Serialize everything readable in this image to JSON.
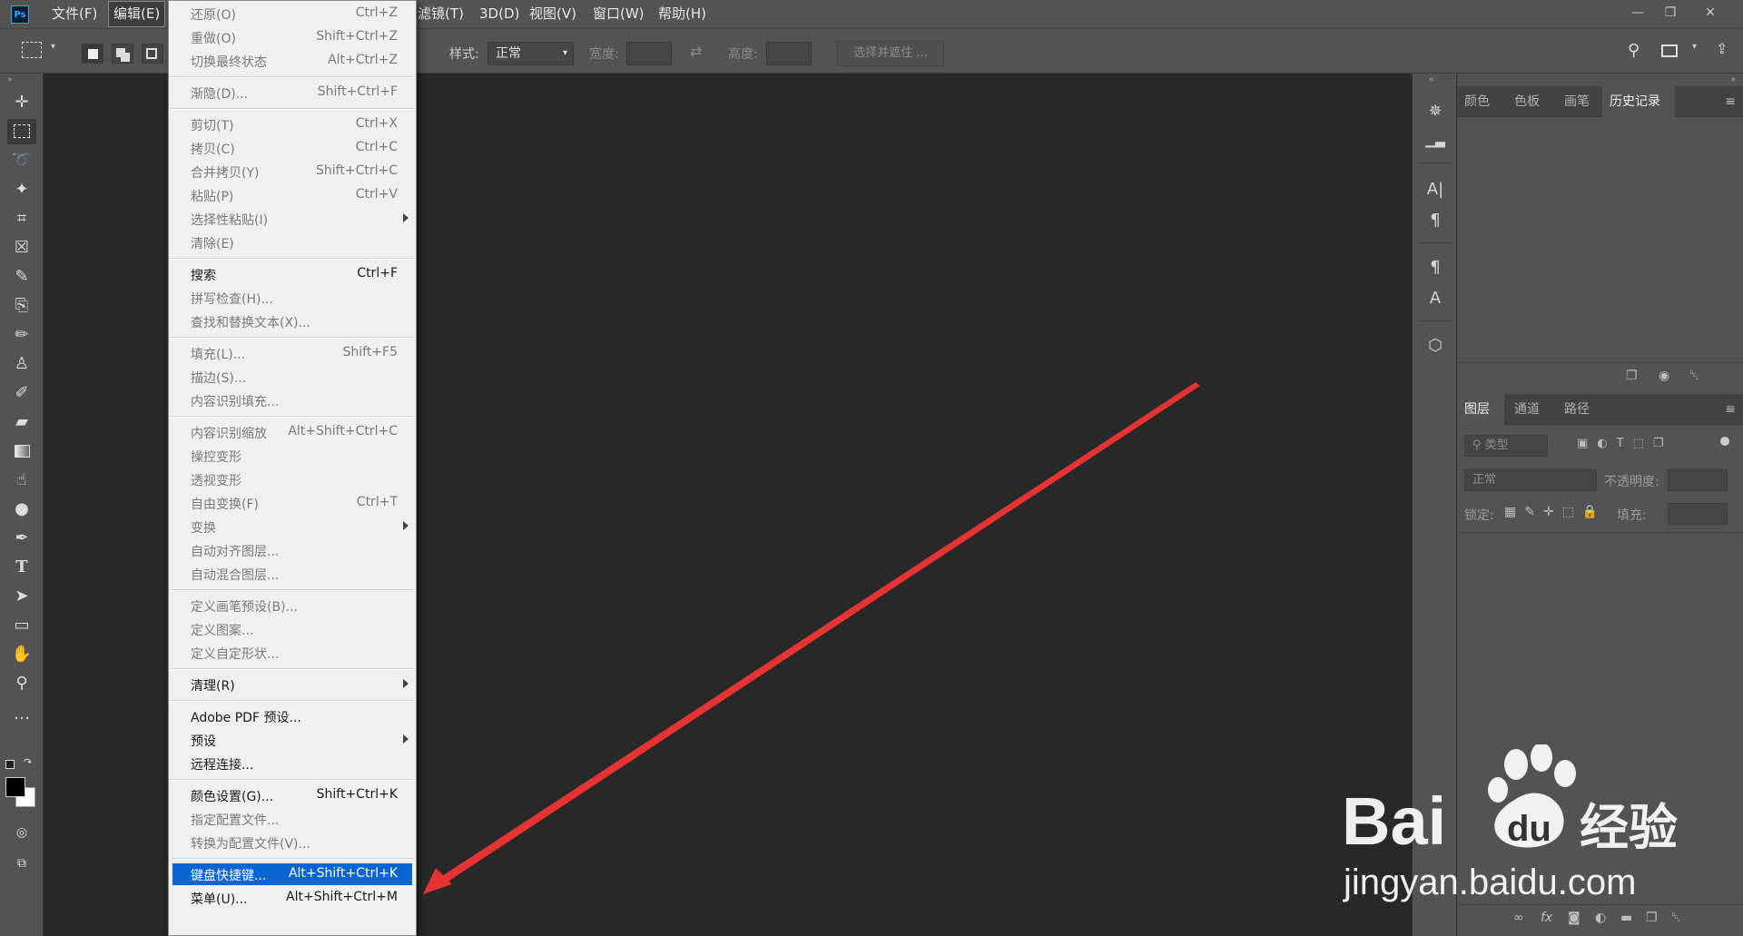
{
  "app": {
    "logo": "Ps"
  },
  "menubar": {
    "items": [
      "文件(F)",
      "编辑(E)",
      "滤镜(T)",
      "3D(D)",
      "视图(V)",
      "窗口(W)",
      "帮助(H)"
    ],
    "active": "编辑(E)"
  },
  "window": {
    "minimize_icon": "minimize-icon",
    "restore_icon": "restore-icon",
    "close_icon": "close-icon"
  },
  "options": {
    "style_label": "样式:",
    "style_value": "正常",
    "width_label": "宽度:",
    "height_label": "高度:",
    "select_mask_label": "选择并遮住 ..."
  },
  "tools": [
    "move-icon",
    "marquee-icon",
    "lasso-icon",
    "magic-wand-icon",
    "crop-icon",
    "frame-icon",
    "eyedropper-icon",
    "healing-icon",
    "brush-icon",
    "stamp-icon",
    "history-brush-icon",
    "eraser-icon",
    "gradient-icon",
    "smudge-icon",
    "dodge-icon",
    "pen-icon",
    "type-icon",
    "path-select-icon",
    "rectangle-icon",
    "hand-icon",
    "zoom-icon",
    "more-icon"
  ],
  "right_panel_top": {
    "tabs": [
      "颜色",
      "色板",
      "画笔",
      "历史记录"
    ],
    "active": "历史记录"
  },
  "layers_panel": {
    "tabs": [
      "图层",
      "通道",
      "路径"
    ],
    "active": "图层",
    "filter_placeholder": "类型",
    "blend_mode": "正常",
    "opacity_label": "不透明度:",
    "lock_label": "锁定:",
    "fill_label": "填充:"
  },
  "edit_menu": {
    "groups": [
      [
        {
          "label": "还原(O)",
          "shortcut": "Ctrl+Z",
          "enabled": false
        },
        {
          "label": "重做(O)",
          "shortcut": "Shift+Ctrl+Z",
          "enabled": false
        },
        {
          "label": "切换最终状态",
          "shortcut": "Alt+Ctrl+Z",
          "enabled": false
        }
      ],
      [
        {
          "label": "渐隐(D)...",
          "shortcut": "Shift+Ctrl+F",
          "enabled": false
        }
      ],
      [
        {
          "label": "剪切(T)",
          "shortcut": "Ctrl+X",
          "enabled": false
        },
        {
          "label": "拷贝(C)",
          "shortcut": "Ctrl+C",
          "enabled": false
        },
        {
          "label": "合并拷贝(Y)",
          "shortcut": "Shift+Ctrl+C",
          "enabled": false
        },
        {
          "label": "粘贴(P)",
          "shortcut": "Ctrl+V",
          "enabled": false
        },
        {
          "label": "选择性粘贴(I)",
          "shortcut": "",
          "enabled": false,
          "submenu": true
        },
        {
          "label": "清除(E)",
          "shortcut": "",
          "enabled": false
        }
      ],
      [
        {
          "label": "搜索",
          "shortcut": "Ctrl+F",
          "enabled": true
        },
        {
          "label": "拼写检查(H)...",
          "shortcut": "",
          "enabled": false
        },
        {
          "label": "查找和替换文本(X)...",
          "shortcut": "",
          "enabled": false
        }
      ],
      [
        {
          "label": "填充(L)...",
          "shortcut": "Shift+F5",
          "enabled": false
        },
        {
          "label": "描边(S)...",
          "shortcut": "",
          "enabled": false
        },
        {
          "label": "内容识别填充...",
          "shortcut": "",
          "enabled": false
        }
      ],
      [
        {
          "label": "内容识别缩放",
          "shortcut": "Alt+Shift+Ctrl+C",
          "enabled": false
        },
        {
          "label": "操控变形",
          "shortcut": "",
          "enabled": false
        },
        {
          "label": "透视变形",
          "shortcut": "",
          "enabled": false
        },
        {
          "label": "自由变换(F)",
          "shortcut": "Ctrl+T",
          "enabled": false
        },
        {
          "label": "变换",
          "shortcut": "",
          "enabled": false,
          "submenu": true
        },
        {
          "label": "自动对齐图层...",
          "shortcut": "",
          "enabled": false
        },
        {
          "label": "自动混合图层...",
          "shortcut": "",
          "enabled": false
        }
      ],
      [
        {
          "label": "定义画笔预设(B)...",
          "shortcut": "",
          "enabled": false
        },
        {
          "label": "定义图案...",
          "shortcut": "",
          "enabled": false
        },
        {
          "label": "定义自定形状...",
          "shortcut": "",
          "enabled": false
        }
      ],
      [
        {
          "label": "清理(R)",
          "shortcut": "",
          "enabled": true,
          "submenu": true
        }
      ],
      [
        {
          "label": "Adobe PDF 预设...",
          "shortcut": "",
          "enabled": true
        },
        {
          "label": "预设",
          "shortcut": "",
          "enabled": true,
          "submenu": true
        },
        {
          "label": "远程连接...",
          "shortcut": "",
          "enabled": true
        }
      ],
      [
        {
          "label": "颜色设置(G)...",
          "shortcut": "Shift+Ctrl+K",
          "enabled": true
        },
        {
          "label": "指定配置文件...",
          "shortcut": "",
          "enabled": false
        },
        {
          "label": "转换为配置文件(V)...",
          "shortcut": "",
          "enabled": false
        }
      ],
      [
        {
          "label": "键盘快捷键...",
          "shortcut": "Alt+Shift+Ctrl+K",
          "enabled": true,
          "highlighted": true
        },
        {
          "label": "菜单(U)...",
          "shortcut": "Alt+Shift+Ctrl+M",
          "enabled": true
        }
      ]
    ]
  },
  "watermark": {
    "brand": "Bai",
    "brand2": "du",
    "cn": "经验",
    "url": "jingyan.baidu.com"
  },
  "colors": {
    "highlight": "#0a64d2",
    "annotation": "#e53333",
    "chrome": "#535353",
    "canvas": "#282828"
  }
}
